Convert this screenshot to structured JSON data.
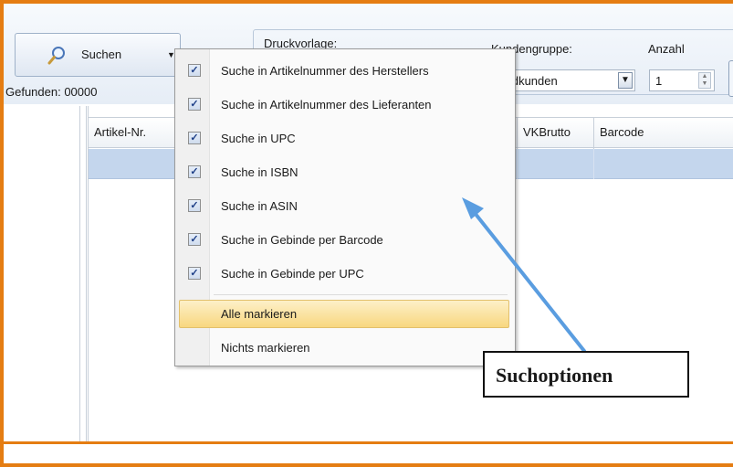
{
  "toolbar": {
    "search_label": "Suchen",
    "found_label": "Gefunden: 00000",
    "druckvorlage_label": "Druckvorlage:",
    "kundengruppe_label": "Kundengruppe:",
    "kundengruppe_value": "...dkunden",
    "anzahl_label": "Anzahl",
    "anzahl_value": "1"
  },
  "grid": {
    "columns": [
      "Artikel-Nr.",
      "VKBrutto",
      "Barcode"
    ]
  },
  "menu": {
    "items": [
      {
        "label": "Suche in Artikelnummer des Herstellers",
        "checked": true
      },
      {
        "label": "Suche in Artikelnummer des Lieferanten",
        "checked": true
      },
      {
        "label": "Suche in UPC",
        "checked": true
      },
      {
        "label": "Suche in ISBN",
        "checked": true
      },
      {
        "label": "Suche in ASIN",
        "checked": true
      },
      {
        "label": "Suche in Gebinde per Barcode",
        "checked": true
      },
      {
        "label": "Suche in Gebinde per UPC",
        "checked": true
      }
    ],
    "select_all": "Alle markieren",
    "select_none": "Nichts markieren"
  },
  "annotation": {
    "callout_text": "Suchoptionen",
    "accent": "#e57d12",
    "arrow_color": "#5a9de0"
  },
  "icons": {
    "search": "magnifier-icon",
    "dropdown": "chevron-down-icon",
    "check": "checkmark-icon"
  }
}
